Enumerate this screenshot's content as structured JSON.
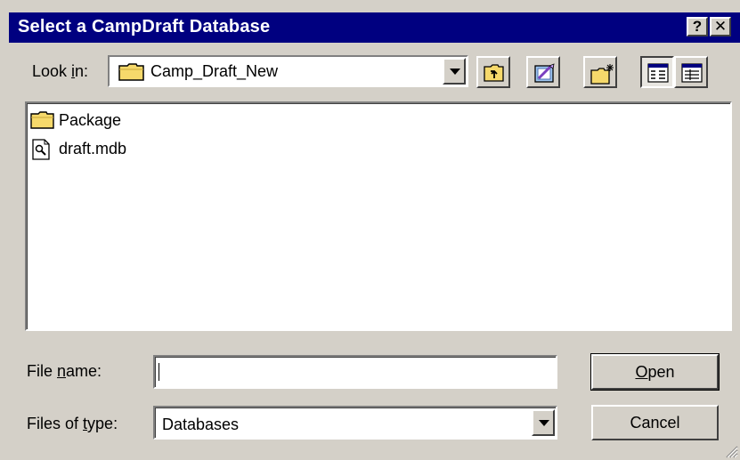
{
  "window": {
    "title": "Select a CampDraft Database",
    "help_glyph": "?",
    "close_glyph": "✕"
  },
  "look_in": {
    "label_before": "Look ",
    "label_accel": "i",
    "label_after": "n:",
    "value": "Camp_Draft_New",
    "icon": "folder-icon"
  },
  "toolbar": {
    "buttons": [
      {
        "name": "up-one-level-button",
        "icon": "up-folder-icon"
      },
      {
        "name": "favorites-button",
        "icon": "favorites-icon"
      },
      {
        "name": "new-folder-button",
        "icon": "new-folder-icon"
      },
      {
        "name": "list-view-button",
        "icon": "list-view-icon"
      },
      {
        "name": "details-view-button",
        "icon": "details-view-icon"
      }
    ]
  },
  "files": [
    {
      "name": "Package",
      "icon": "folder-icon"
    },
    {
      "name": "draft.mdb",
      "icon": "database-file-icon"
    }
  ],
  "file_name": {
    "label_before": "File ",
    "label_accel": "n",
    "label_after": "ame:",
    "value": ""
  },
  "file_type": {
    "label_before": "Files of ",
    "label_accel": "t",
    "label_after": "ype:",
    "value": "Databases"
  },
  "buttons": {
    "open_accel": "O",
    "open_rest": "pen",
    "cancel": "Cancel"
  },
  "colors": {
    "titlebar": "#000080",
    "face": "#d4d0c8",
    "folder": "#f6d96b"
  }
}
